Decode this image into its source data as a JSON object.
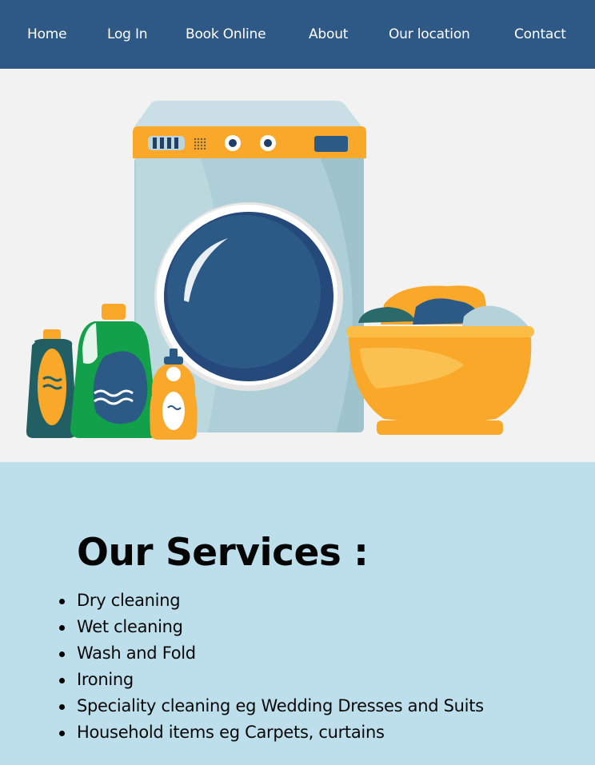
{
  "nav": {
    "items": [
      {
        "label": "Home",
        "name": "nav-home"
      },
      {
        "label": "Log In",
        "name": "nav-log-in"
      },
      {
        "label": "Book Online",
        "name": "nav-book-online"
      },
      {
        "label": "About",
        "name": "nav-about"
      },
      {
        "label": "Our location",
        "name": "nav-our-location"
      },
      {
        "label": "Contact",
        "name": "nav-contact"
      }
    ]
  },
  "colors": {
    "nav_bg": "#2e5886",
    "hero_bg": "#f2f2f2",
    "services_bg": "#bddfeb",
    "accent_orange": "#f9a82a",
    "drum_blue": "#2c5a87"
  },
  "hero": {
    "illustration": "washing-machine-laundry-illustration"
  },
  "services": {
    "heading": "Our Services :",
    "items": [
      "Dry cleaning",
      "Wet cleaning",
      "Wash and Fold",
      "Ironing",
      "Speciality cleaning eg Wedding Dresses and Suits",
      "Household items eg Carpets, curtains"
    ]
  }
}
